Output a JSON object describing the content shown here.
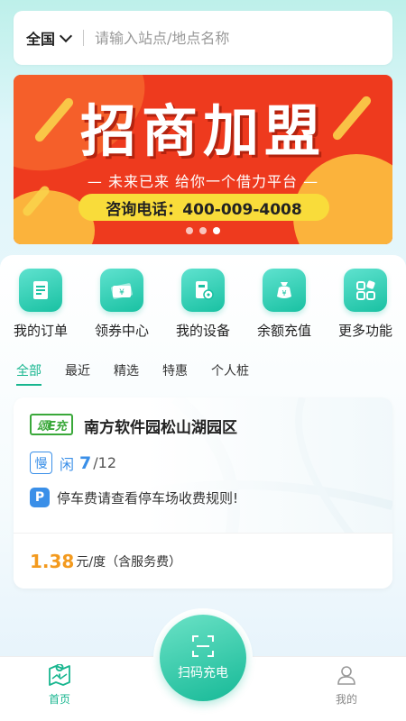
{
  "search": {
    "region": "全国",
    "placeholder": "请输入站点/地点名称"
  },
  "banner": {
    "title": "招商加盟",
    "subtitle": "— 未来已来  给你一个借力平台 —",
    "phone": "咨询电话：400-009-4008",
    "slide_count": 3,
    "active_slide": 3
  },
  "quick_actions": [
    {
      "label": "我的订单",
      "icon": "order-icon"
    },
    {
      "label": "领券中心",
      "icon": "coupon-icon"
    },
    {
      "label": "我的设备",
      "icon": "device-icon"
    },
    {
      "label": "余额充值",
      "icon": "wallet-icon"
    },
    {
      "label": "更多功能",
      "icon": "more-icon"
    }
  ],
  "tabs": [
    "全部",
    "最近",
    "精选",
    "特惠",
    "个人桩"
  ],
  "active_tab": "全部",
  "station": {
    "brand": "颂E充",
    "name": "南方软件园松山湖园区",
    "slow_badge": "慢",
    "idle_label": "闲",
    "idle_count": "7",
    "total": "/12",
    "parking_badge": "P",
    "parking_note": "停车费请查看停车场收费规则!",
    "price": "1.38",
    "price_unit": "元/度（含服务费）"
  },
  "nav": {
    "home": "首页",
    "scan": "扫码充电",
    "me": "我的"
  },
  "colors": {
    "accent": "#18b68f",
    "price": "#f39a1e",
    "info_blue": "#3a8fe8",
    "banner_red": "#ee3a1e",
    "banner_yellow": "#f9dc3a"
  }
}
